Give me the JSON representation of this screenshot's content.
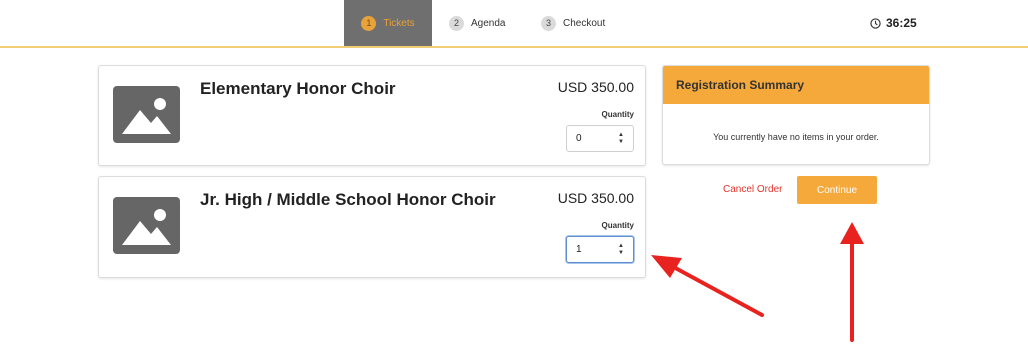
{
  "nav": {
    "steps": [
      {
        "num": "1",
        "label": "Tickets"
      },
      {
        "num": "2",
        "label": "Agenda"
      },
      {
        "num": "3",
        "label": "Checkout"
      }
    ],
    "timer": "36:25"
  },
  "tickets": [
    {
      "title": "Elementary Honor Choir",
      "price": "USD 350.00",
      "qty_label": "Quantity",
      "qty_value": "0"
    },
    {
      "title": "Jr. High / Middle School Honor Choir",
      "price": "USD 350.00",
      "qty_label": "Quantity",
      "qty_value": "1"
    }
  ],
  "summary": {
    "title": "Registration Summary",
    "empty_text": "You currently have no items in your order."
  },
  "actions": {
    "cancel_label": "Cancel Order",
    "continue_label": "Continue"
  },
  "colors": {
    "accent": "#f6a93b",
    "cancel": "#e0352e",
    "annotation_arrow": "#e8231f"
  },
  "icons": [
    "image-placeholder-icon",
    "clock-icon",
    "spinner-up-icon",
    "spinner-down-icon"
  ]
}
